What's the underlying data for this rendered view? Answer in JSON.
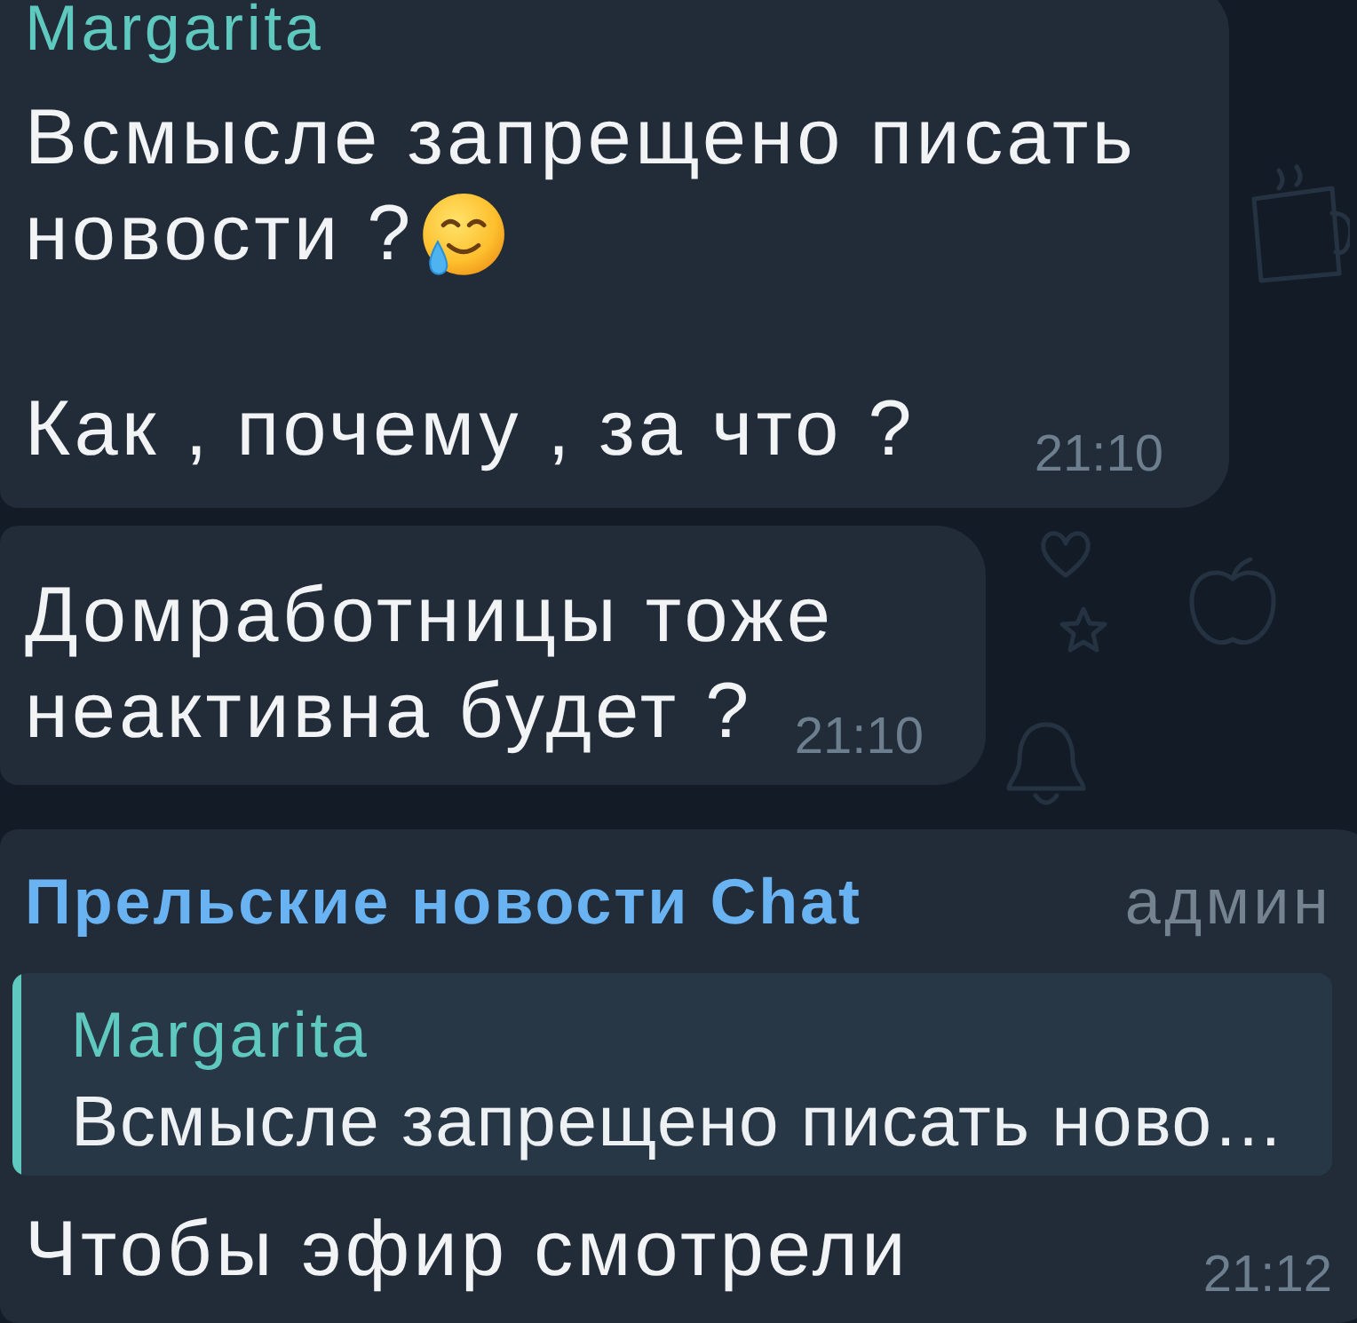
{
  "chat": {
    "messages": [
      {
        "sender": {
          "name": "Margarita",
          "color": "#5fc9c0"
        },
        "paragraphs": [
          {
            "lines": [
              "Всмысле запрещено писать",
              "новости ?"
            ],
            "emoji": true
          },
          {
            "lines": [
              "Как , почему , за что ?"
            ]
          }
        ],
        "time": "21:10"
      },
      {
        "paragraphs": [
          {
            "lines": [
              "Домработницы тоже",
              "неактивна будет ?"
            ]
          }
        ],
        "time": "21:10"
      },
      {
        "sender": {
          "name": "Прельские новости Chat",
          "color": "#6ab3f3"
        },
        "role": "админ",
        "reply": {
          "sender": {
            "name": "Margarita",
            "color": "#5fc9c0"
          },
          "text": "Всмысле запрещено писать ново…"
        },
        "paragraphs": [
          {
            "lines": [
              "Чтобы эфир смотрели"
            ]
          }
        ],
        "time": "21:12"
      }
    ]
  }
}
